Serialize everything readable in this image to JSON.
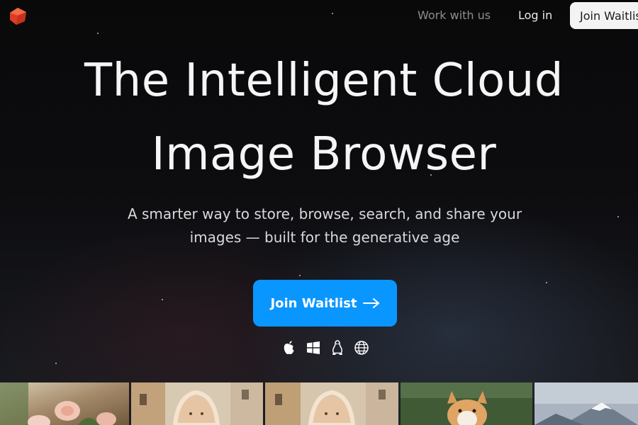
{
  "header": {
    "logo_icon": "red-cube-logo-icon",
    "nav": {
      "work_with_us": "Work with us",
      "log_in": "Log in",
      "join_waitlist": "Join Waitlist"
    }
  },
  "hero": {
    "title_line1": "The Intelligent Cloud",
    "title_line2": "Image Browser",
    "subtitle_line1": "A smarter way to store, browse, search, and share your",
    "subtitle_line2": "images — built for the generative age",
    "cta_label": "Join Waitlist",
    "cta_icon": "arrow-right-icon"
  },
  "platforms": [
    "apple-icon",
    "windows-icon",
    "linux-icon",
    "globe-icon"
  ],
  "gallery": {
    "thumbnails": [
      "roses-garden-thumbnail",
      "woman-portrait-street-thumbnail",
      "woman-portrait-street-thumbnail",
      "corgi-dog-thumbnail",
      "snowy-mountain-thumbnail"
    ]
  },
  "colors": {
    "background": "#0b0b0d",
    "accent": "#0a96ff",
    "logo_red": "#e8452c"
  }
}
